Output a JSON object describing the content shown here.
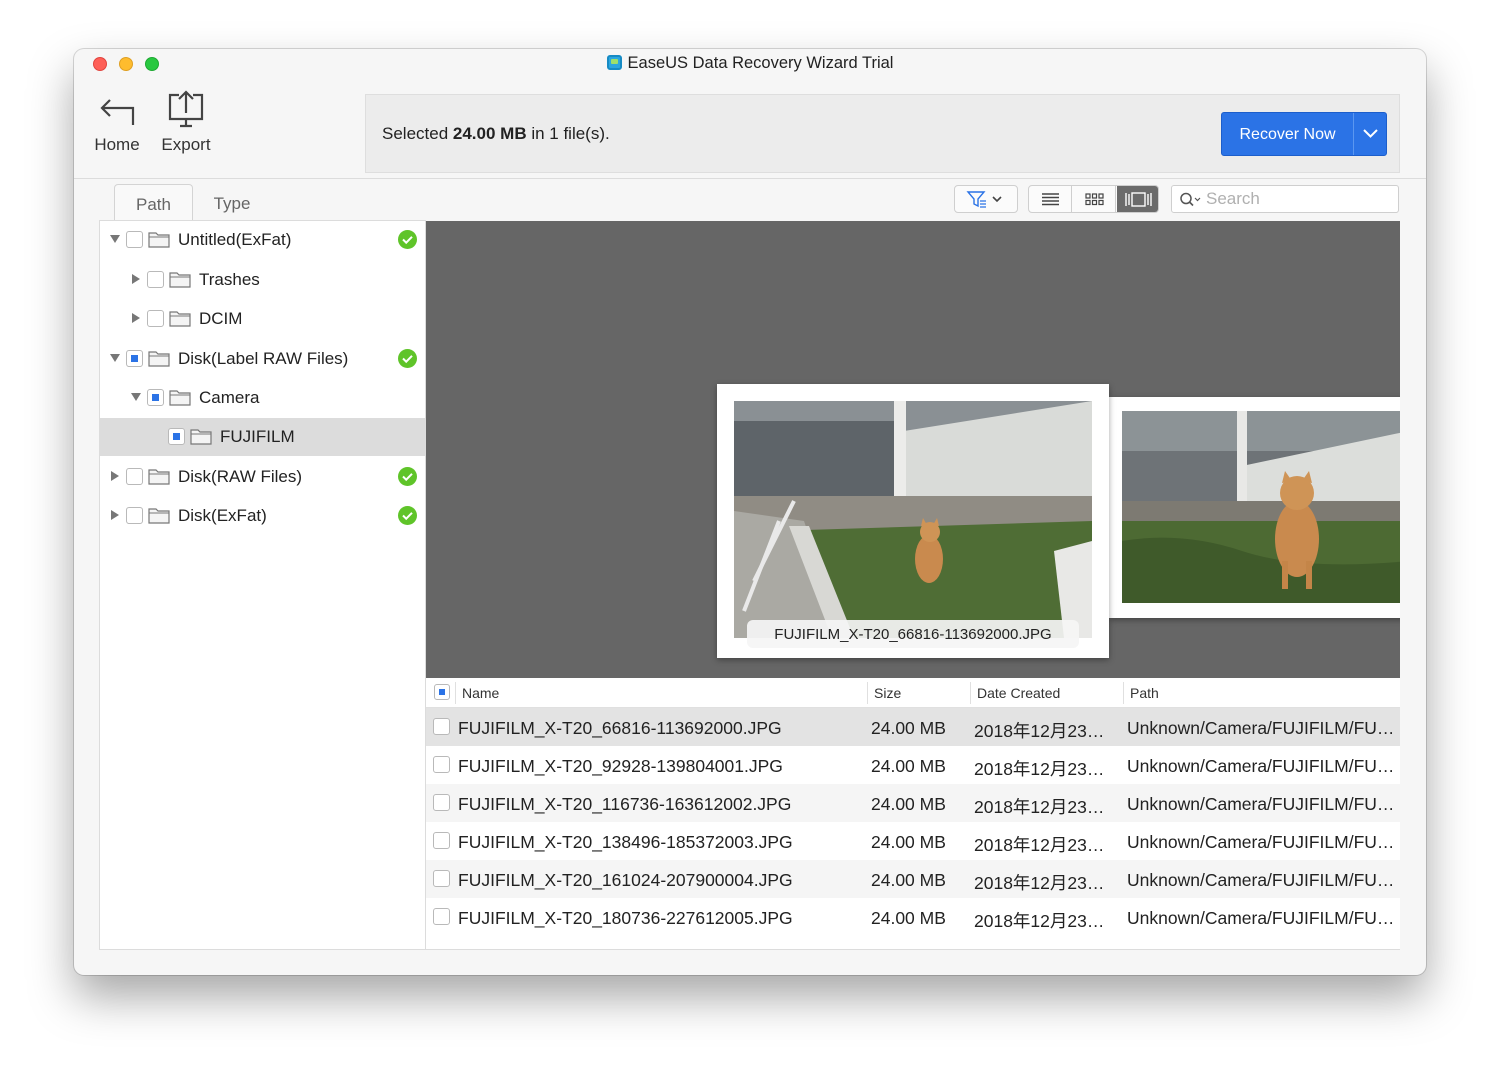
{
  "window": {
    "title": "EaseUS Data Recovery Wizard Trial"
  },
  "toolbar": {
    "home_label": "Home",
    "export_label": "Export"
  },
  "info_bar": {
    "prefix": "Selected ",
    "size": "24.00 MB",
    "suffix": " in 1 file(s).",
    "recover_label": "Recover Now"
  },
  "tabs": {
    "path": "Path",
    "type": "Type"
  },
  "search": {
    "placeholder": "Search"
  },
  "tree": [
    {
      "label": "Untitled(ExFat)"
    },
    {
      "label": "Trashes"
    },
    {
      "label": "DCIM"
    },
    {
      "label": "Disk(Label RAW Files)"
    },
    {
      "label": "Camera"
    },
    {
      "label": "FUJIFILM"
    },
    {
      "label": "Disk(RAW Files)"
    },
    {
      "label": "Disk(ExFat)"
    }
  ],
  "preview": {
    "caption": "FUJIFILM_X-T20_66816-113692000.JPG"
  },
  "table": {
    "columns": {
      "name": "Name",
      "size": "Size",
      "date": "Date Created",
      "path": "Path"
    },
    "rows": [
      {
        "name": "FUJIFILM_X-T20_66816-113692000.JPG",
        "size": "24.00 MB",
        "date": "2018年12月23…",
        "path": "Unknown/Camera/FUJIFILM/FU…"
      },
      {
        "name": "FUJIFILM_X-T20_92928-139804001.JPG",
        "size": "24.00 MB",
        "date": "2018年12月23…",
        "path": "Unknown/Camera/FUJIFILM/FU…"
      },
      {
        "name": "FUJIFILM_X-T20_116736-163612002.JPG",
        "size": "24.00 MB",
        "date": "2018年12月23…",
        "path": "Unknown/Camera/FUJIFILM/FU…"
      },
      {
        "name": "FUJIFILM_X-T20_138496-185372003.JPG",
        "size": "24.00 MB",
        "date": "2018年12月23…",
        "path": "Unknown/Camera/FUJIFILM/FU…"
      },
      {
        "name": "FUJIFILM_X-T20_161024-207900004.JPG",
        "size": "24.00 MB",
        "date": "2018年12月23…",
        "path": "Unknown/Camera/FUJIFILM/FU…"
      },
      {
        "name": "FUJIFILM_X-T20_180736-227612005.JPG",
        "size": "24.00 MB",
        "date": "2018年12月23…",
        "path": "Unknown/Camera/FUJIFILM/FU…"
      }
    ]
  },
  "colors": {
    "accent": "#2b73e6",
    "success": "#5fc429",
    "preview_bg": "#666666"
  },
  "icons": [
    "home-icon",
    "export-icon",
    "filter-icon",
    "list-view-icon",
    "grid-view-icon",
    "coverflow-view-icon",
    "search-icon",
    "folder-icon",
    "check-icon"
  ]
}
